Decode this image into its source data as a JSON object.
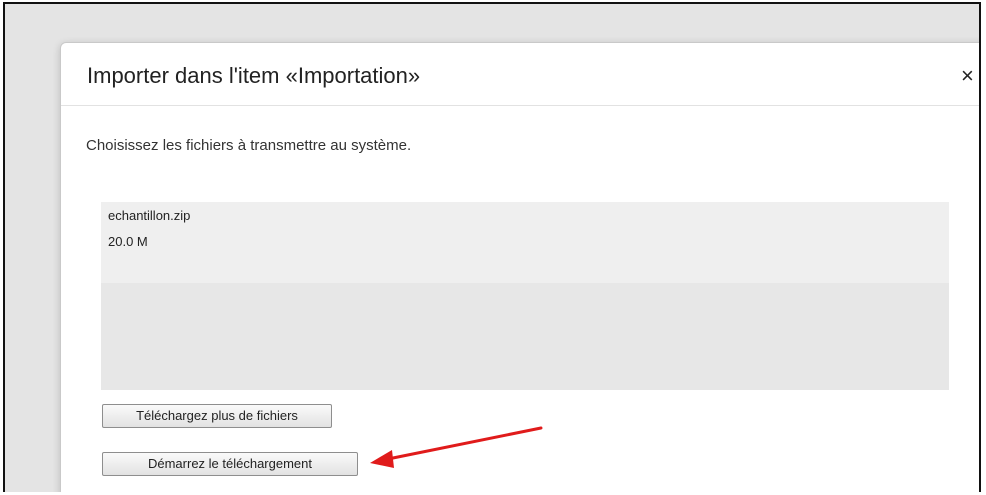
{
  "dialog": {
    "title": "Importer dans l'item «Importation»",
    "close_label": "×",
    "instructions": "Choisissez les fichiers à transmettre au système."
  },
  "files": [
    {
      "name": "echantillon.zip",
      "size": "20.0 M"
    }
  ],
  "buttons": {
    "add_more": "Téléchargez plus de fichiers",
    "start_upload": "Démarrez le téléchargement"
  },
  "colors": {
    "annotation_arrow": "#e01b1b",
    "backdrop": "#e4e4e4",
    "file_list_background": "#e7e7e7"
  }
}
